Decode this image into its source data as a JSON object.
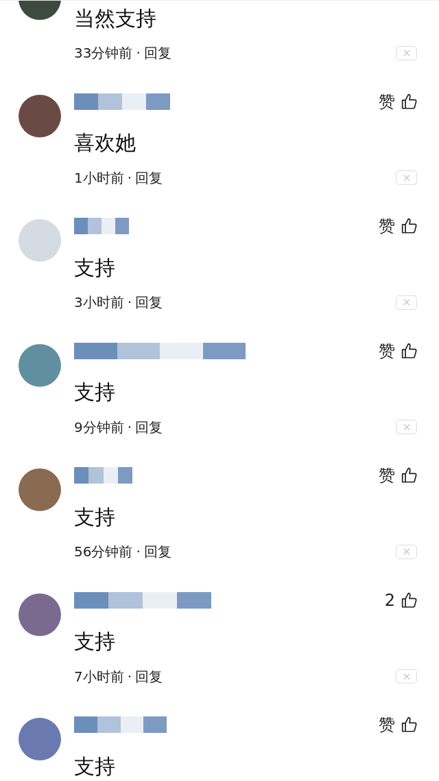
{
  "comments": [
    {
      "kind": "partial",
      "text": "当然支持",
      "time": "33分钟前",
      "separator": "·",
      "reply": "回复"
    },
    {
      "kind": "full",
      "text": "喜欢她",
      "time": "1小时前",
      "separator": "·",
      "reply": "回复",
      "likes": "赞"
    },
    {
      "kind": "full",
      "text": "支持",
      "time": "3小时前",
      "separator": "·",
      "reply": "回复",
      "likes": "赞"
    },
    {
      "kind": "full",
      "text": "支持",
      "time": "9分钟前",
      "separator": "·",
      "reply": "回复",
      "likes": "赞"
    },
    {
      "kind": "full",
      "text": "支持",
      "time": "56分钟前",
      "separator": "·",
      "reply": "回复",
      "likes": "赞"
    },
    {
      "kind": "full",
      "text": "支持",
      "time": "7小时前",
      "separator": "·",
      "reply": "回复",
      "likes": "2"
    },
    {
      "kind": "full",
      "text": "支持",
      "likes": "赞"
    }
  ]
}
